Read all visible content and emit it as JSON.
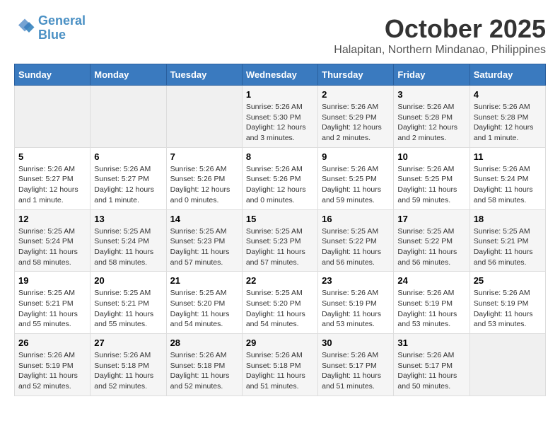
{
  "logo": {
    "line1": "General",
    "line2": "Blue"
  },
  "header": {
    "month": "October 2025",
    "location": "Halapitan, Northern Mindanao, Philippines"
  },
  "weekdays": [
    "Sunday",
    "Monday",
    "Tuesday",
    "Wednesday",
    "Thursday",
    "Friday",
    "Saturday"
  ],
  "weeks": [
    [
      {
        "day": "",
        "empty": true
      },
      {
        "day": "",
        "empty": true
      },
      {
        "day": "",
        "empty": true
      },
      {
        "day": "1",
        "sunrise": "5:26 AM",
        "sunset": "5:30 PM",
        "daylight": "12 hours and 3 minutes."
      },
      {
        "day": "2",
        "sunrise": "5:26 AM",
        "sunset": "5:29 PM",
        "daylight": "12 hours and 2 minutes."
      },
      {
        "day": "3",
        "sunrise": "5:26 AM",
        "sunset": "5:28 PM",
        "daylight": "12 hours and 2 minutes."
      },
      {
        "day": "4",
        "sunrise": "5:26 AM",
        "sunset": "5:28 PM",
        "daylight": "12 hours and 1 minute."
      }
    ],
    [
      {
        "day": "5",
        "sunrise": "5:26 AM",
        "sunset": "5:27 PM",
        "daylight": "12 hours and 1 minute."
      },
      {
        "day": "6",
        "sunrise": "5:26 AM",
        "sunset": "5:27 PM",
        "daylight": "12 hours and 1 minute."
      },
      {
        "day": "7",
        "sunrise": "5:26 AM",
        "sunset": "5:26 PM",
        "daylight": "12 hours and 0 minutes."
      },
      {
        "day": "8",
        "sunrise": "5:26 AM",
        "sunset": "5:26 PM",
        "daylight": "12 hours and 0 minutes."
      },
      {
        "day": "9",
        "sunrise": "5:26 AM",
        "sunset": "5:25 PM",
        "daylight": "11 hours and 59 minutes."
      },
      {
        "day": "10",
        "sunrise": "5:26 AM",
        "sunset": "5:25 PM",
        "daylight": "11 hours and 59 minutes."
      },
      {
        "day": "11",
        "sunrise": "5:26 AM",
        "sunset": "5:24 PM",
        "daylight": "11 hours and 58 minutes."
      }
    ],
    [
      {
        "day": "12",
        "sunrise": "5:25 AM",
        "sunset": "5:24 PM",
        "daylight": "11 hours and 58 minutes."
      },
      {
        "day": "13",
        "sunrise": "5:25 AM",
        "sunset": "5:24 PM",
        "daylight": "11 hours and 58 minutes."
      },
      {
        "day": "14",
        "sunrise": "5:25 AM",
        "sunset": "5:23 PM",
        "daylight": "11 hours and 57 minutes."
      },
      {
        "day": "15",
        "sunrise": "5:25 AM",
        "sunset": "5:23 PM",
        "daylight": "11 hours and 57 minutes."
      },
      {
        "day": "16",
        "sunrise": "5:25 AM",
        "sunset": "5:22 PM",
        "daylight": "11 hours and 56 minutes."
      },
      {
        "day": "17",
        "sunrise": "5:25 AM",
        "sunset": "5:22 PM",
        "daylight": "11 hours and 56 minutes."
      },
      {
        "day": "18",
        "sunrise": "5:25 AM",
        "sunset": "5:21 PM",
        "daylight": "11 hours and 56 minutes."
      }
    ],
    [
      {
        "day": "19",
        "sunrise": "5:25 AM",
        "sunset": "5:21 PM",
        "daylight": "11 hours and 55 minutes."
      },
      {
        "day": "20",
        "sunrise": "5:25 AM",
        "sunset": "5:21 PM",
        "daylight": "11 hours and 55 minutes."
      },
      {
        "day": "21",
        "sunrise": "5:25 AM",
        "sunset": "5:20 PM",
        "daylight": "11 hours and 54 minutes."
      },
      {
        "day": "22",
        "sunrise": "5:25 AM",
        "sunset": "5:20 PM",
        "daylight": "11 hours and 54 minutes."
      },
      {
        "day": "23",
        "sunrise": "5:26 AM",
        "sunset": "5:19 PM",
        "daylight": "11 hours and 53 minutes."
      },
      {
        "day": "24",
        "sunrise": "5:26 AM",
        "sunset": "5:19 PM",
        "daylight": "11 hours and 53 minutes."
      },
      {
        "day": "25",
        "sunrise": "5:26 AM",
        "sunset": "5:19 PM",
        "daylight": "11 hours and 53 minutes."
      }
    ],
    [
      {
        "day": "26",
        "sunrise": "5:26 AM",
        "sunset": "5:19 PM",
        "daylight": "11 hours and 52 minutes."
      },
      {
        "day": "27",
        "sunrise": "5:26 AM",
        "sunset": "5:18 PM",
        "daylight": "11 hours and 52 minutes."
      },
      {
        "day": "28",
        "sunrise": "5:26 AM",
        "sunset": "5:18 PM",
        "daylight": "11 hours and 52 minutes."
      },
      {
        "day": "29",
        "sunrise": "5:26 AM",
        "sunset": "5:18 PM",
        "daylight": "11 hours and 51 minutes."
      },
      {
        "day": "30",
        "sunrise": "5:26 AM",
        "sunset": "5:17 PM",
        "daylight": "11 hours and 51 minutes."
      },
      {
        "day": "31",
        "sunrise": "5:26 AM",
        "sunset": "5:17 PM",
        "daylight": "11 hours and 50 minutes."
      },
      {
        "day": "",
        "empty": true
      }
    ]
  ],
  "colors": {
    "header_bg": "#3a7abf",
    "odd_row": "#f5f5f5",
    "even_row": "#ffffff"
  }
}
